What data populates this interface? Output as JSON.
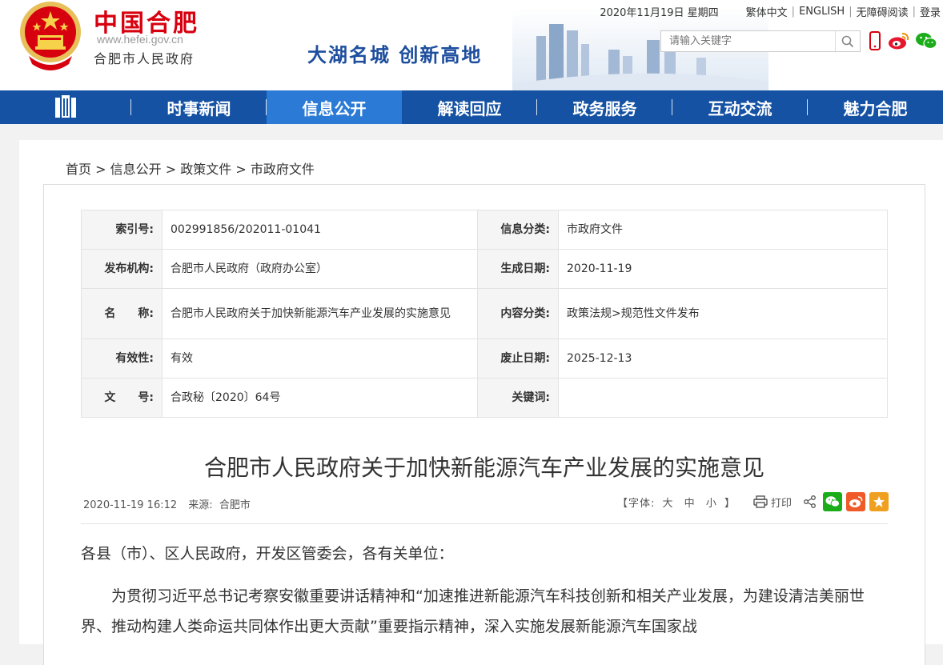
{
  "header": {
    "logo_cn": "中国合肥",
    "logo_url": "www.hefei.gov.cn",
    "logo_sub": "合肥市人民政府",
    "slogan": "大湖名城  创新高地",
    "date": "2020年11月19日 星期四",
    "links": {
      "traditional": "繁体中文",
      "english": "ENGLISH",
      "accessible": "无障碍阅读",
      "login": "登录"
    },
    "search_placeholder": "请输入关键字"
  },
  "nav": {
    "items": [
      {
        "label": "时事新闻"
      },
      {
        "label": "信息公开"
      },
      {
        "label": "解读回应"
      },
      {
        "label": "政务服务"
      },
      {
        "label": "互动交流"
      },
      {
        "label": "魅力合肥"
      }
    ]
  },
  "breadcrumb": [
    "首页",
    "信息公开",
    "政策文件",
    "市政府文件"
  ],
  "meta": {
    "index_label": "索引号:",
    "index_value": "002991856/202011-01041",
    "category_label": "信息分类:",
    "category_value": "市政府文件",
    "issuer_label": "发布机构:",
    "issuer_value": "合肥市人民政府（政府办公室）",
    "date_label": "生成日期:",
    "date_value": "2020-11-19",
    "name_label": "名　　称:",
    "name_value": "合肥市人民政府关于加快新能源汽车产业发展的实施意见",
    "content_label": "内容分类:",
    "content_value": "政策法规>规范性文件发布",
    "validity_label": "有效性:",
    "validity_value": "有效",
    "expire_label": "废止日期:",
    "expire_value": "2025-12-13",
    "docno_label": "文　　号:",
    "docno_value": "合政秘〔2020〕64号",
    "keywords_label": "关键词:",
    "keywords_value": ""
  },
  "article": {
    "title": "合肥市人民政府关于加快新能源汽车产业发展的实施意见",
    "datetime": "2020-11-19 16:12",
    "source_label": "来源:",
    "source": "合肥市",
    "font_label": "【字体:",
    "font_large": "大",
    "font_medium": "中",
    "font_small": "小",
    "font_close": "】",
    "print_label": "打印",
    "salutation": "各县（市）、区人民政府，开发区管委会，各有关单位：",
    "para1": "为贯彻习近平总书记考察安徽重要讲话精神和“加速推进新能源汽车科技创新和相关产业发展，为建设清洁美丽世界、推动构建人类命运共同体作出更大贡献”重要指示精神，深入实施发展新能源汽车国家战"
  },
  "colors": {
    "nav_bg": "#1552a4",
    "nav_active": "#2b7ad6",
    "brand_red": "#d7000f",
    "slogan_blue": "#1d4e9e"
  }
}
